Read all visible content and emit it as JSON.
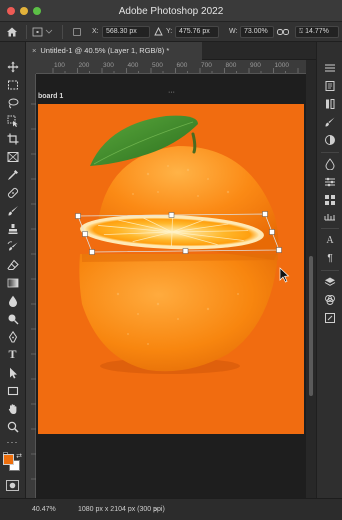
{
  "window": {
    "title": "Adobe Photoshop 2022"
  },
  "options_bar": {
    "x_label": "X:",
    "x_value": "568.30 px",
    "y_label": "Y:",
    "y_value": "475.76 px",
    "w_label": "W:",
    "w_value": "73.00%",
    "h_value": "14.77%"
  },
  "document": {
    "tab_label": "Untitled-1 @ 40.5% (Layer 1, RGB/8) *",
    "artboard_label": "board 1"
  },
  "ruler": {
    "ticks": [
      "100",
      "200",
      "300",
      "400",
      "500",
      "600",
      "700",
      "800",
      "900",
      "1000"
    ]
  },
  "status": {
    "zoom": "40.47%",
    "doc_info": "1080 px x 2104 px (300 ppi)",
    "arrow": ">"
  },
  "colors": {
    "foreground": "#ee6f0d",
    "background": "#ffffff",
    "canvas": "#f16c10"
  },
  "toolbar_icons": [
    "move-icon",
    "artboard-icon",
    "marquee-icon",
    "lasso-icon",
    "object-select-icon",
    "crop-icon",
    "frame-icon",
    "eyedropper-icon",
    "healing-brush-icon",
    "brush-icon",
    "clone-stamp-icon",
    "history-brush-icon",
    "eraser-icon",
    "gradient-icon",
    "blur-icon",
    "dodge-icon",
    "pen-icon",
    "type-icon",
    "path-select-icon",
    "rectangle-icon",
    "hand-icon",
    "zoom-icon"
  ],
  "right_panel_icons": [
    "layers-icon",
    "adjustments-icon",
    "properties-icon",
    "libraries-icon",
    "color-icon",
    "swatches-icon",
    "gradients-icon",
    "patterns-icon",
    "character-icon",
    "paragraph-icon",
    "channels-icon",
    "paths-icon",
    "history-icon"
  ]
}
